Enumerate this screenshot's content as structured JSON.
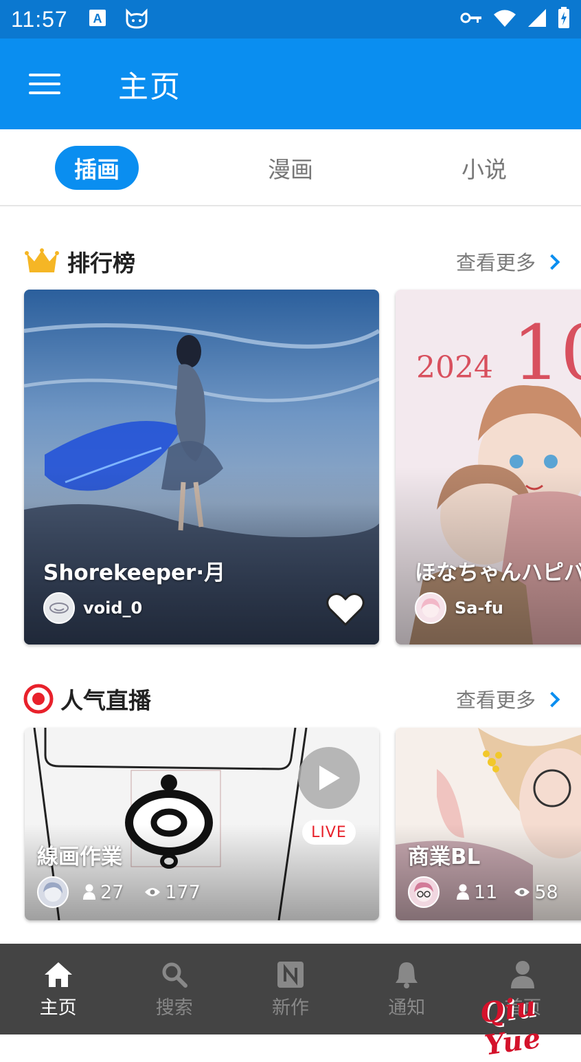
{
  "status_bar": {
    "time": "11:57"
  },
  "app_bar": {
    "title": "主页"
  },
  "tabs": [
    {
      "label": "插画",
      "active": true
    },
    {
      "label": "漫画",
      "active": false
    },
    {
      "label": "小说",
      "active": false
    }
  ],
  "ranking": {
    "title": "排行榜",
    "see_more": "查看更多",
    "cards": [
      {
        "title": "Shorekeeper·月",
        "author": "void_0",
        "liked": true
      },
      {
        "title": "ほなちゃんハピバ",
        "author": "Sa-fu"
      }
    ]
  },
  "live": {
    "title": "人气直播",
    "see_more": "查看更多",
    "badge": "LIVE",
    "cards": [
      {
        "title": "線画作業",
        "viewers": "27",
        "views": "177"
      },
      {
        "title": "商業BL",
        "viewers": "11",
        "views": "58"
      }
    ]
  },
  "bottom_nav": [
    {
      "label": "主页",
      "icon": "home-icon",
      "active": true
    },
    {
      "label": "搜索",
      "icon": "search-icon",
      "active": false
    },
    {
      "label": "新作",
      "icon": "new-works-icon",
      "active": false
    },
    {
      "label": "通知",
      "icon": "bell-icon",
      "active": false
    },
    {
      "label": "首页",
      "icon": "person-icon",
      "active": false
    }
  ],
  "watermark": "Qiu Yue",
  "colors": {
    "primary": "#0a8ef0",
    "status_bar": "#0b78d0",
    "nav_bg": "#444444",
    "live_red": "#e8212b"
  }
}
